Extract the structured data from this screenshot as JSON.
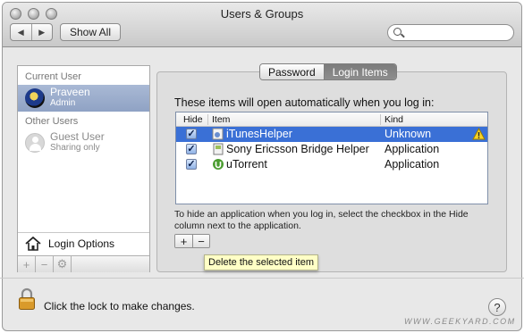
{
  "window": {
    "title": "Users & Groups"
  },
  "toolbar": {
    "show_all_label": "Show All",
    "back_glyph": "◀",
    "forward_glyph": "▶",
    "search_placeholder": ""
  },
  "sidebar": {
    "current_user_header": "Current User",
    "current_user": {
      "name": "Praveen",
      "role": "Admin"
    },
    "other_users_header": "Other Users",
    "other_users": [
      {
        "name": "Guest User",
        "status": "Sharing only"
      }
    ],
    "login_options_label": "Login Options",
    "buttons": {
      "add": "+",
      "remove": "−",
      "action": "⚙"
    }
  },
  "tabs": [
    {
      "label": "Password",
      "active": false
    },
    {
      "label": "Login Items",
      "active": true
    }
  ],
  "login_items": {
    "heading": "These items will open automatically when you log in:",
    "columns": {
      "hide": "Hide",
      "item": "Item",
      "kind": "Kind"
    },
    "rows": [
      {
        "hide": true,
        "item": "iTunesHelper",
        "kind": "Unknown",
        "selected": true,
        "warning": true,
        "icon": "itunes-helper-icon"
      },
      {
        "hide": true,
        "item": "Sony Ericsson Bridge Helper",
        "kind": "Application",
        "selected": false,
        "warning": false,
        "icon": "sony-ericsson-icon"
      },
      {
        "hide": true,
        "item": "uTorrent",
        "kind": "Application",
        "selected": false,
        "warning": false,
        "icon": "utorrent-icon"
      }
    ],
    "hint": "To hide an application when you log in, select the checkbox in the Hide column next to the application.",
    "add_label": "+",
    "remove_label": "−",
    "tooltip": "Delete the selected item"
  },
  "footer": {
    "lock_text": "Click the lock to make changes.",
    "help_label": "?"
  },
  "watermark": "WWW.GEEKYARD.COM",
  "colors": {
    "selection": "#3a70d6",
    "sidebar_selection": "#9aabcb",
    "tooltip_bg": "#ffffc6"
  }
}
